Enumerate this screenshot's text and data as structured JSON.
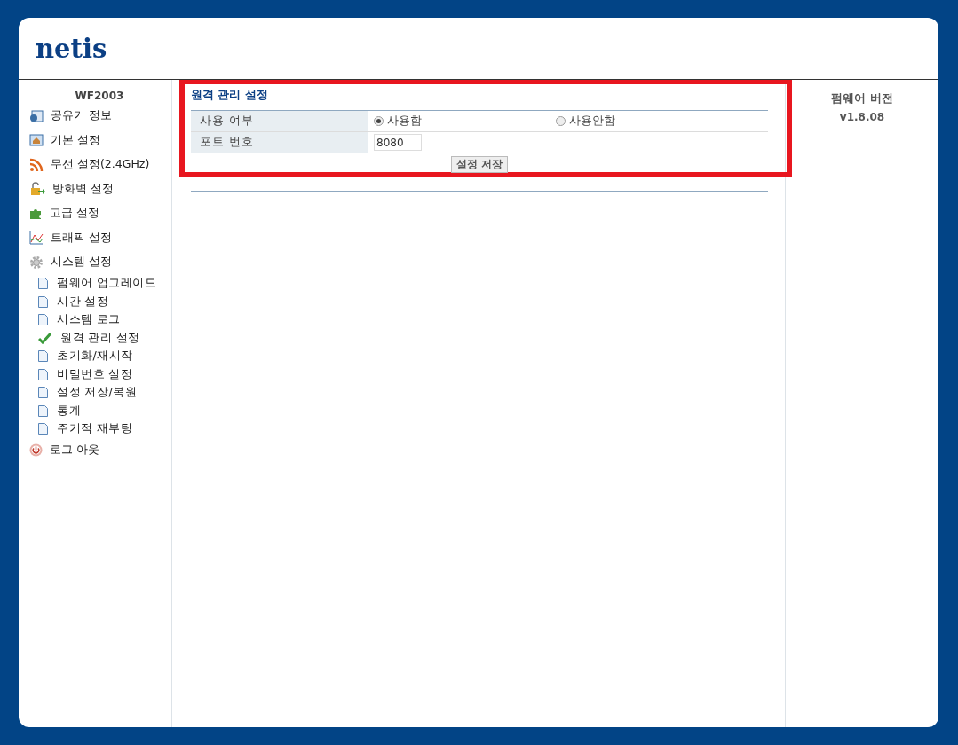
{
  "logo": "netis",
  "sidebar": {
    "model": "WF2003",
    "items": [
      {
        "label": "공유기 정보"
      },
      {
        "label": "기본 설정"
      },
      {
        "label": "무선 설정(2.4GHz)"
      },
      {
        "label": "방화벽 설정"
      },
      {
        "label": "고급 설정"
      },
      {
        "label": "트래픽 설정"
      },
      {
        "label": "시스템 설정",
        "children": [
          {
            "label": "펌웨어 업그레이드",
            "selected": false
          },
          {
            "label": "시간 설정",
            "selected": false
          },
          {
            "label": "시스템 로그",
            "selected": false
          },
          {
            "label": "원격 관리 설정",
            "selected": true
          },
          {
            "label": "초기화/재시작",
            "selected": false
          },
          {
            "label": "비밀번호 설정",
            "selected": false
          },
          {
            "label": "설정 저장/복원",
            "selected": false
          },
          {
            "label": "통계",
            "selected": false
          },
          {
            "label": "주기적 재부팅",
            "selected": false
          }
        ]
      },
      {
        "label": "로그 아웃"
      }
    ]
  },
  "section": {
    "title": "원격 관리 설정",
    "rows": [
      {
        "kind": "radio",
        "label": "사용 여부",
        "options": [
          {
            "label": "사용함",
            "selected": true
          },
          {
            "label": "사용안함",
            "selected": false
          }
        ]
      },
      {
        "kind": "input",
        "label": "포트 번호",
        "value": "8080"
      }
    ],
    "save_button": "설정 저장"
  },
  "firmware": {
    "title": "펌웨어 버전",
    "version": "v1.8.08"
  }
}
